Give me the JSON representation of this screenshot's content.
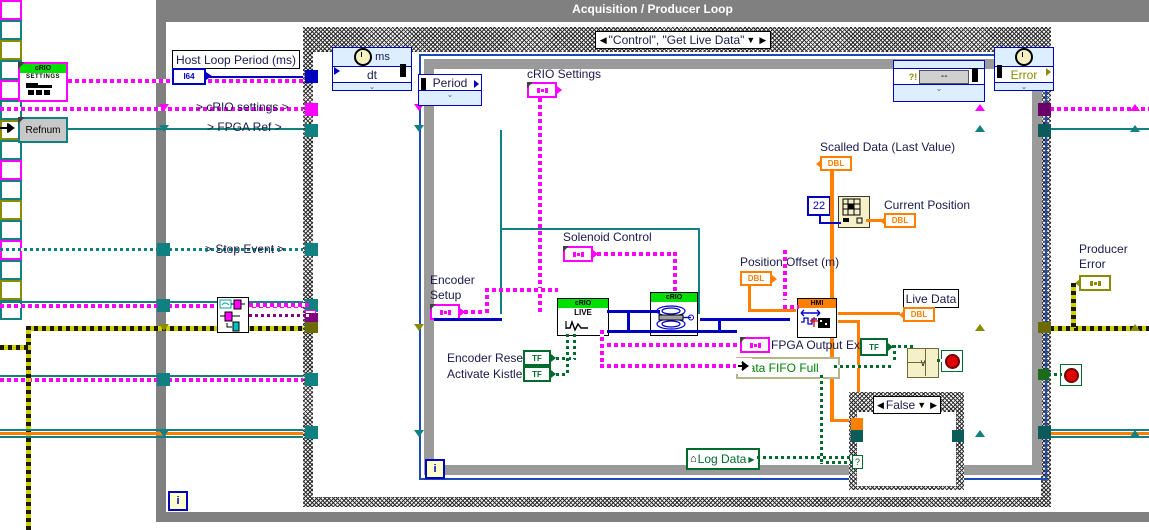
{
  "window": {
    "title": "Acquisition / Producer Loop"
  },
  "case_structure": {
    "selector_label": "\"Control\", \"Get Live Data\"",
    "left_arrow": "◀",
    "right_arrow": "▶",
    "dropdown_arrow": "▼"
  },
  "inner_case": {
    "selector_label": "False",
    "left_arrow": "◀",
    "right_arrow": "▶",
    "dropdown_arrow": "▼"
  },
  "controls": {
    "host_loop_period": {
      "label": "Host Loop Period (ms)",
      "type": "I64"
    },
    "crio_settings_control": {
      "header": "cRIO",
      "sub": "SETTINGS"
    },
    "refnum": {
      "label": "Refnum"
    },
    "crio_settings_tunnel": {
      "label": "cRIO Settings"
    },
    "encoder_setup": {
      "label_line1": "Encoder",
      "label_line2": "Setup"
    },
    "solenoid_control": {
      "label": "Solenoid Control"
    },
    "encoder_reset": {
      "label": "Encoder Reset",
      "value": "TF"
    },
    "activate_kistler": {
      "label": "Activate Kistler",
      "value": "TF"
    },
    "position_offset": {
      "label": "Position Offset (m)",
      "type": "DBL"
    },
    "fpga_output": {
      "label": "FPGA Output"
    },
    "exit": {
      "label": "Exit",
      "value": "TF"
    },
    "array_index": {
      "value": "22"
    }
  },
  "indicators": {
    "scalled_data": {
      "label": "Scalled Data (Last Value)",
      "type": "DBL"
    },
    "current_position": {
      "label": "Current Position",
      "type": "DBL"
    },
    "live_data": {
      "label": "Live Data",
      "type": "DBL"
    },
    "producer_error": {
      "label_line1": "Producer",
      "label_line2": "Error"
    },
    "error_display": {
      "value": "--"
    }
  },
  "shift_register_labels": {
    "crio_settings": "> cRIO settings >",
    "fpga_ref": "> FPGA Ref >",
    "stop_event": "> Stop Event >"
  },
  "timing_nodes": {
    "wait_ms": {
      "units": "ms",
      "input": "dt",
      "chevron": "⌄"
    },
    "period": {
      "input": "Period",
      "chevron": "⌄"
    },
    "error_node": {
      "input": "Error",
      "chevron": "⌄"
    },
    "display_node": {
      "chevron": "⌄",
      "prefix": "?!"
    }
  },
  "subvis": {
    "crio_live": {
      "header": "cRIO",
      "title": "LIVE"
    },
    "crio_solenoid": {
      "header": "cRIO"
    },
    "hmi_node": {
      "header": "HMI"
    }
  },
  "buttons": {
    "log_data": {
      "label": "Log Data",
      "house_icon": "⌂",
      "arrow": "▶"
    },
    "data_fifo_full": {
      "label": "Data FIFO Full"
    }
  },
  "misc": {
    "context_help": "i",
    "or_gate": "∨",
    "question_mark": "?"
  },
  "colors": {
    "cluster_pink": "#ff00ff",
    "refnum_teal": "#108080",
    "numeric_blue": "#0000c0",
    "double_orange": "#ff7f00",
    "boolean_green": "#006b2d",
    "error_olive": "#8b8b00",
    "frame_grey": "#808080",
    "crio_green": "#00e000",
    "hmi_orange": "#ff7f00"
  }
}
